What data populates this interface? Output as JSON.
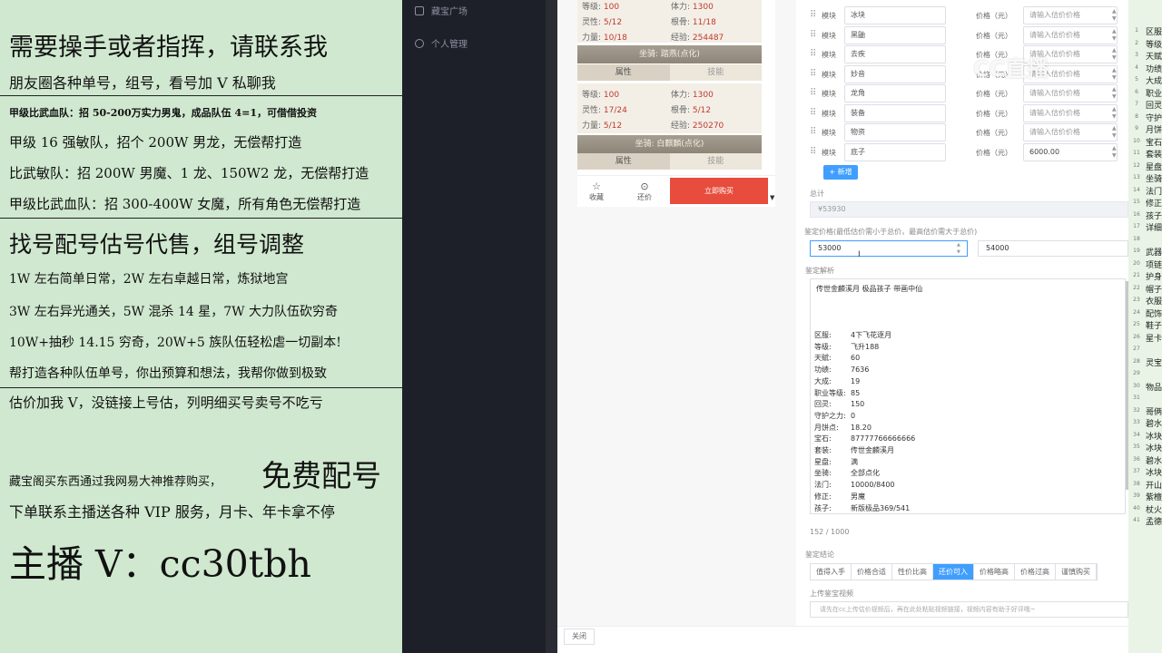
{
  "promo": {
    "l1": "需要操手或者指挥，请联系我",
    "l2": "朋友圈各种单号，组号，看号加 V 私聊我",
    "l3": "甲级比武血队：招 50-200万实力男鬼，成品队伍 4=1，可借借投资",
    "l4": "甲级 16 强敏队，招个 200W 男龙，无偿帮打造",
    "l5": "比武敏队：招 200W 男魔、1 龙、150W2 龙，无偿帮打造",
    "l6": "甲级比武血队：招 300-400W 女魔，所有角色无偿帮打造",
    "l7": "找号配号估号代售，组号调整",
    "l8": "1W 左右简单日常，2W 左右卓越日常，炼狱地宫",
    "l9": "3W 左右异光通关，5W 混杀 14 星，7W 大力队伍砍穷奇",
    "l10": "10W+抽秒 14.15 穷奇，20W+5 族队伍轻松虐一切副本!",
    "l11": "帮打造各种队伍单号，你出预算和想法，我帮你做到极致",
    "l12": "估价加我 V，没链接上号估，列明细买号卖号不吃亏",
    "l13a": "藏宝阁买东西通过我网易大神推荐购买，",
    "l13b": "免费配号",
    "l14": "下单联系主播送各种 VIP 服务，月卡、年卡拿不停",
    "l15": "主播 V：cc30tbh"
  },
  "sidebar": {
    "item1": "藏宝广场",
    "item2": "个人管理"
  },
  "card1": {
    "r1": [
      {
        "k": "等级:",
        "v": "100"
      },
      {
        "k": "体力:",
        "v": "1300"
      }
    ],
    "r2": [
      {
        "k": "灵性:",
        "v": "5/12"
      },
      {
        "k": "根骨:",
        "v": "11/18"
      }
    ],
    "r3": [
      {
        "k": "力量:",
        "v": "10/18"
      },
      {
        "k": "经验:",
        "v": "254487"
      }
    ]
  },
  "mount2": {
    "head": "坐骑: 踏燕(点化)",
    "tab_a": "属性",
    "tab_b": "技能",
    "r1": [
      {
        "k": "等级:",
        "v": "100"
      },
      {
        "k": "体力:",
        "v": "1300"
      }
    ],
    "r2": [
      {
        "k": "灵性:",
        "v": "17/24"
      },
      {
        "k": "根骨:",
        "v": "5/12"
      }
    ],
    "r3": [
      {
        "k": "力量:",
        "v": "5/12"
      },
      {
        "k": "经验:",
        "v": "250270"
      }
    ]
  },
  "mount3": {
    "head": "坐骑: 白麒麟(点化)",
    "tab_a": "属性",
    "tab_b": "技能"
  },
  "bottom": {
    "fav": "收藏",
    "bargain": "还价",
    "buy": "立即购买"
  },
  "modules": [
    {
      "lab": "模块",
      "name": "冰块",
      "plab": "价格（元）",
      "price": "请输入估价价格",
      "filled": false
    },
    {
      "lab": "模块",
      "name": "黑鼬",
      "plab": "价格（元）",
      "price": "请输入估价价格",
      "filled": false
    },
    {
      "lab": "模块",
      "name": "去疾",
      "plab": "价格（元）",
      "price": "请输入估价价格",
      "filled": false
    },
    {
      "lab": "模块",
      "name": "妙音",
      "plab": "价格（元）",
      "price": "请输入估价价格",
      "filled": false
    },
    {
      "lab": "模块",
      "name": "龙角",
      "plab": "价格（元）",
      "price": "请输入估价价格",
      "filled": false
    },
    {
      "lab": "模块",
      "name": "装备",
      "plab": "价格（元）",
      "price": "请输入估价价格",
      "filled": false
    },
    {
      "lab": "模块",
      "name": "物资",
      "plab": "价格（元）",
      "price": "请输入估价价格",
      "filled": false
    },
    {
      "lab": "模块",
      "name": "底子",
      "plab": "价格（元）",
      "price": "6000.00",
      "filled": true
    }
  ],
  "form": {
    "add": "+ 新增",
    "total_label": "总计",
    "total_value": "¥53930",
    "range_label": "鉴定价格(最低估价需小于总价，最高估价需大于总价)",
    "min": "53000",
    "max": "54000",
    "analysis_label": "鉴定解析",
    "analysis_title": "传世金麟溪月 极品孩子 带画中仙",
    "counter": "152 / 1000",
    "conclusion_label": "鉴定结论",
    "conclusions": [
      "值得入手",
      "价格合适",
      "性价比高",
      "还价可入",
      "价格略高",
      "价格过高",
      "谨慎购买"
    ],
    "video_label": "上传鉴宝视频",
    "video_placeholder": "请先在cc上传估价视频后，再在此处粘贴视频链接，视频内容有助于好评哦~",
    "close": "关闭"
  },
  "analysis": [
    {
      "k": "区服:",
      "v": "4下飞花逐月"
    },
    {
      "k": "等级:",
      "v": "飞升188"
    },
    {
      "k": "天赋:",
      "v": "60"
    },
    {
      "k": "功绩:",
      "v": "7636"
    },
    {
      "k": "大成:",
      "v": "19"
    },
    {
      "k": "职业等级:",
      "v": "85"
    },
    {
      "k": "回灵:",
      "v": "150"
    },
    {
      "k": "守护之力:",
      "v": "0"
    },
    {
      "k": "月饼点:",
      "v": "18.20"
    },
    {
      "k": "宝石:",
      "v": "87777766666666"
    },
    {
      "k": "套装:",
      "v": "传世金麟溪月"
    },
    {
      "k": "星盘:",
      "v": "满"
    },
    {
      "k": "坐骑:",
      "v": "全部点化"
    },
    {
      "k": "法门:",
      "v": "10000/8400"
    },
    {
      "k": "修正:",
      "v": "男魔"
    },
    {
      "k": "孩子:",
      "v": "新版极品369/541"
    }
  ],
  "watermark": "CC直播",
  "strip": {
    "lines": [
      "区服",
      "等级",
      "天赋",
      "功绩",
      "大成",
      "职业",
      "回灵",
      "守护",
      "月饼",
      "宝石",
      "套装",
      "星盘",
      "坐骑",
      "法门",
      "修正",
      "孩子",
      "详细",
      "",
      "武器",
      "项链",
      "护身",
      "帽子",
      "衣服",
      "配饰",
      "鞋子",
      "星卡",
      "",
      "灵宝",
      "",
      "物品",
      "",
      "哥俩",
      "碧水",
      "冰块",
      "冰块",
      "碧水",
      "冰块",
      "开山",
      "紫檀",
      "杖火",
      "孟德"
    ]
  }
}
